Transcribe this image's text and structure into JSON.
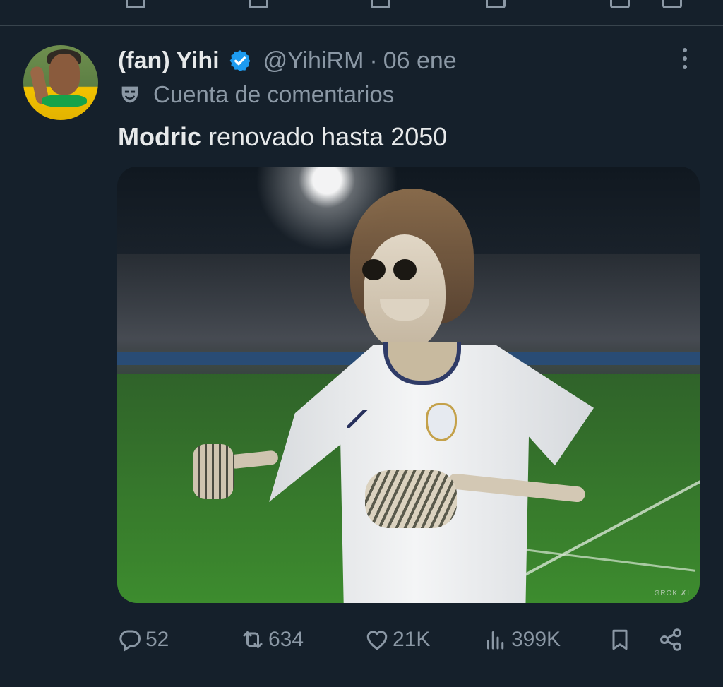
{
  "tweet": {
    "author_name": "(fan) Yihi",
    "handle": "@YihiRM",
    "separator": "·",
    "date": "06 ene",
    "account_label": "Cuenta de comentarios",
    "text_bold": "Modric",
    "text_rest": " renovado hasta 2050"
  },
  "media": {
    "watermark": "GROK ✗I"
  },
  "actions": {
    "replies": "52",
    "reposts": "634",
    "likes": "21K",
    "views": "399K"
  },
  "colors": {
    "background": "#15202b",
    "secondary_text": "#8b98a5",
    "verified": "#1d9bf0"
  },
  "icons": [
    "verified-badge-icon",
    "mask-icon",
    "more-icon",
    "reply-icon",
    "repost-icon",
    "like-icon",
    "views-icon",
    "bookmark-icon",
    "share-icon"
  ]
}
